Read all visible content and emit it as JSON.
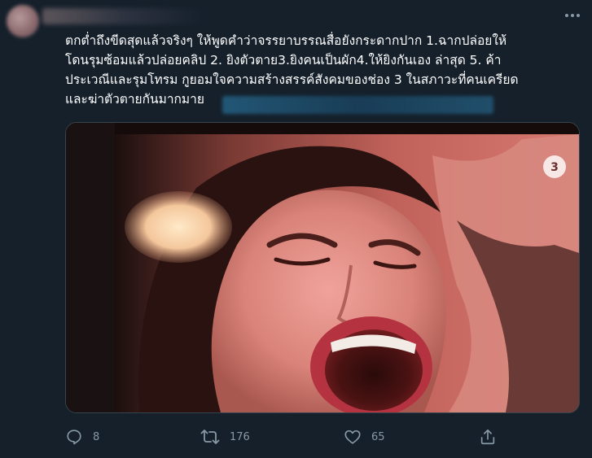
{
  "tweet": {
    "text": "ตกต่ำถึงขีดสุดแล้วจริงๆ ให้พูดคำว่าจรรยาบรรณสื่อยังกระดากปาก 1.ฉากปล่อยให้\nโดนรุมซ้อมแล้วปล่อยคลิป 2. ยิงตัวตาย3.ยิงคนเป็นผัก4.ให้ยิงกันเอง ล่าสุด 5. ค้า\nประเวณีและรุมโทรม กูยอมใจความสร้างสรรค์สังคมของช่อง 3 ในสภาวะที่คนเครียด\nและฆ่าตัวตายกันมากมาย"
  },
  "actions": {
    "replies": "8",
    "retweets": "176",
    "likes": "65"
  },
  "icons": {
    "more": "more-horizontal-icon",
    "reply": "reply-icon",
    "retweet": "retweet-icon",
    "like": "heart-icon",
    "share": "share-icon"
  },
  "colors": {
    "background": "#15202b",
    "text": "#ffffff",
    "muted": "#8899a6",
    "border": "#38444d"
  }
}
